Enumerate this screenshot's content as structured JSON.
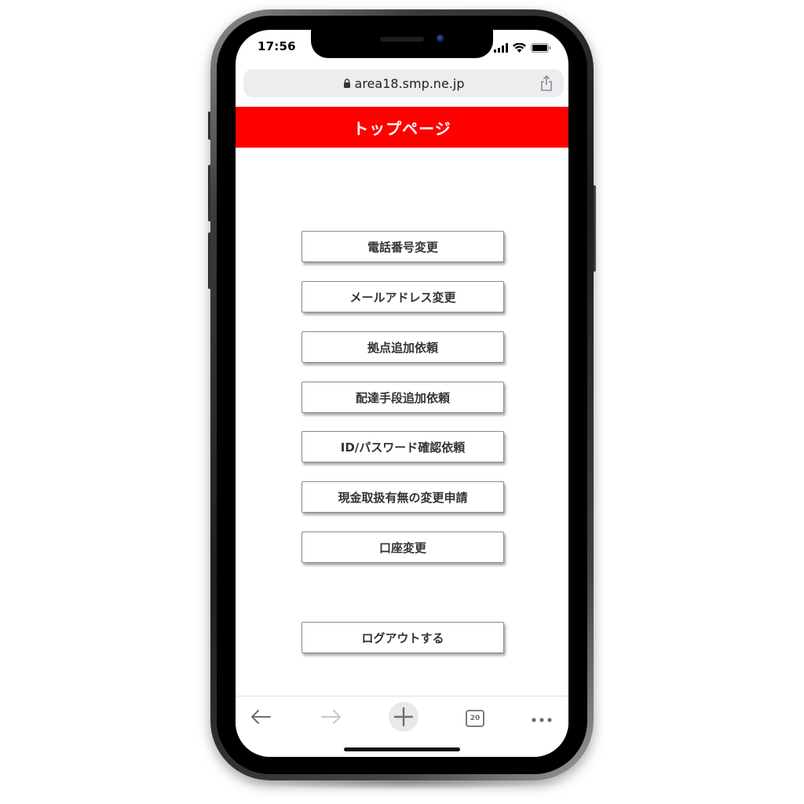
{
  "status_bar": {
    "time": "17:56",
    "icons": [
      "signal-icon",
      "wifi-icon",
      "battery-icon"
    ]
  },
  "browser": {
    "url": "area18.smp.ne.jp",
    "lock_icon": "lock-icon",
    "share_icon": "share-icon",
    "tab_count": "20",
    "nav_icons": [
      "back-arrow-icon",
      "forward-arrow-icon",
      "new-tab-plus-icon",
      "tabs-icon",
      "more-dots-icon"
    ]
  },
  "header": {
    "title": "トップページ"
  },
  "menu": {
    "items": [
      "電話番号変更",
      "メールアドレス変更",
      "拠点追加依頼",
      "配達手段追加依頼",
      "ID/パスワード確認依頼",
      "現金取扱有無の変更申請",
      "口座変更"
    ],
    "logout_label": "ログアウトする"
  },
  "colors": {
    "header_bg": "#ff0000",
    "header_text": "#ffffff",
    "button_text": "#333333"
  }
}
